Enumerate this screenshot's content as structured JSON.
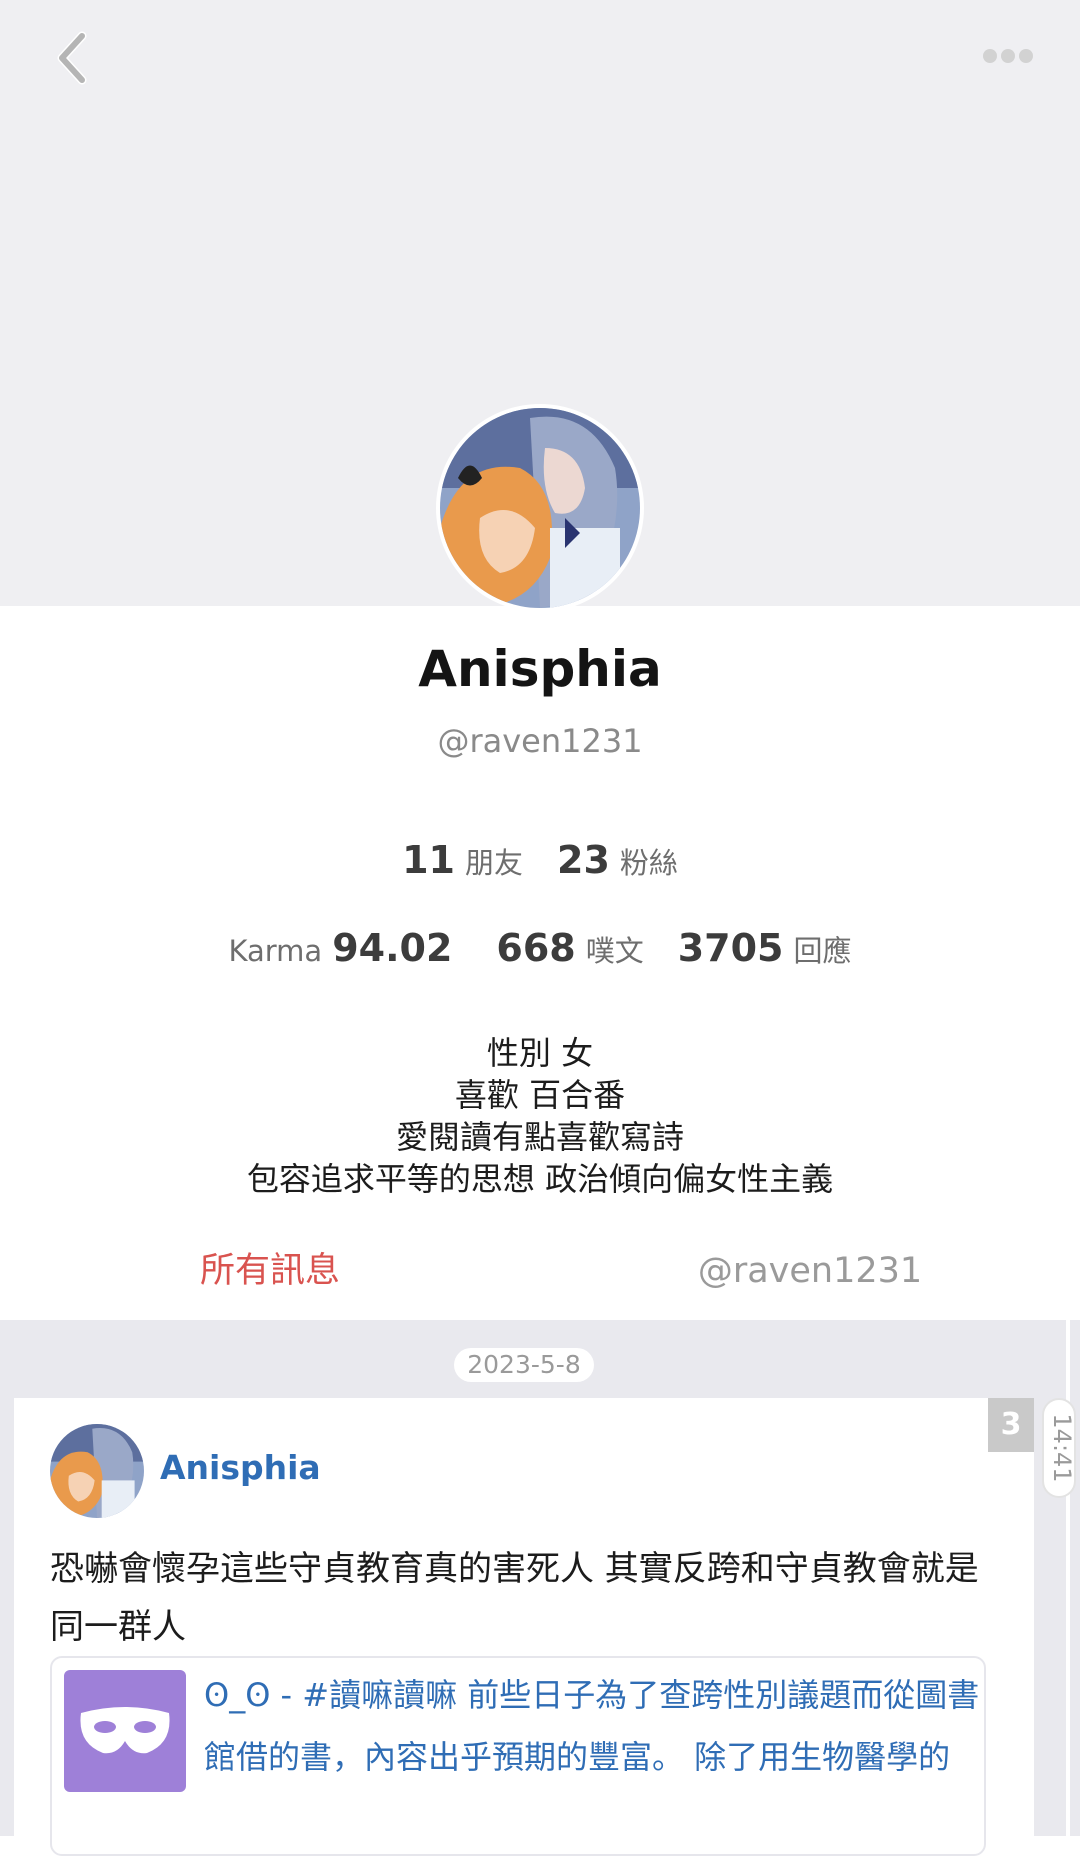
{
  "header": {
    "back_icon": "chevron-left-icon",
    "more_icon": "more-dots-icon"
  },
  "profile": {
    "name": "Anisphia",
    "handle": "@raven1231",
    "friends_count": "11",
    "friends_label": "朋友",
    "fans_count": "23",
    "fans_label": "粉絲",
    "karma_label": "Karma",
    "karma_value": "94.02",
    "plurks_count": "668",
    "plurks_label": "噗文",
    "responses_count": "3705",
    "responses_label": "回應",
    "bio_lines": [
      "性別 女",
      "喜歡 百合番",
      "愛閱讀有點喜歡寫詩",
      "包容追求平等的思想 政治傾向偏女性主義"
    ]
  },
  "tabs": [
    {
      "label": "所有訊息",
      "active": true
    },
    {
      "label": "@raven1231",
      "active": false
    }
  ],
  "feed": {
    "date": "2023-5-8",
    "post": {
      "author": "Anisphia",
      "response_count": "3",
      "time": "14:41",
      "text": "恐嚇會懷孕這些守貞教育真的害死人 其實反跨和守貞教會就是同一群人",
      "quote": {
        "icon": "mask-icon",
        "text": "ʘ_ʘ - #讀嘛讀嘛 前些日子為了查跨性別議題而從圖書館借的書，內容出乎預期的豐富。 除了用生物醫學的"
      }
    }
  },
  "colors": {
    "accent": "#e0574f",
    "link": "#2f6db5",
    "header_bg": "#efeff2",
    "quote_thumb": "#9e80d8"
  }
}
